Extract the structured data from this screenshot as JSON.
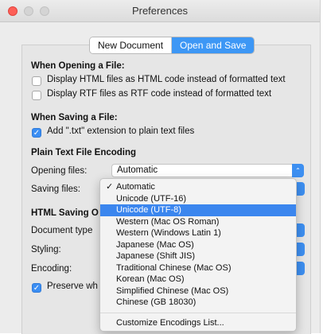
{
  "window": {
    "title": "Preferences"
  },
  "tabs": [
    {
      "label": "New Document",
      "active": false
    },
    {
      "label": "Open and Save",
      "active": true
    }
  ],
  "opening": {
    "heading": "When Opening a File:",
    "options": [
      {
        "label": "Display HTML files as HTML code instead of formatted text",
        "checked": false
      },
      {
        "label": "Display RTF files as RTF code instead of formatted text",
        "checked": false
      }
    ]
  },
  "saving": {
    "heading": "When Saving a File:",
    "options": [
      {
        "label": "Add \".txt\" extension to plain text files",
        "checked": true
      }
    ]
  },
  "encoding": {
    "heading": "Plain Text File Encoding",
    "opening_label": "Opening files:",
    "opening_value": "Automatic",
    "saving_label": "Saving files:"
  },
  "html_saving": {
    "heading_partial": "HTML Saving O",
    "doctype_label": "Document type",
    "styling_label": "Styling:",
    "encoding_label": "Encoding:",
    "preserve_partial": "Preserve wh"
  },
  "menu": {
    "items": [
      {
        "label": "Automatic",
        "checked": true,
        "selected": false
      },
      {
        "label": "Unicode (UTF-16)",
        "checked": false,
        "selected": false
      },
      {
        "label": "Unicode (UTF-8)",
        "checked": false,
        "selected": true
      },
      {
        "label": "Western (Mac OS Roman)",
        "checked": false,
        "selected": false
      },
      {
        "label": "Western (Windows Latin 1)",
        "checked": false,
        "selected": false
      },
      {
        "label": "Japanese (Mac OS)",
        "checked": false,
        "selected": false
      },
      {
        "label": "Japanese (Shift JIS)",
        "checked": false,
        "selected": false
      },
      {
        "label": "Traditional Chinese (Mac OS)",
        "checked": false,
        "selected": false
      },
      {
        "label": "Korean (Mac OS)",
        "checked": false,
        "selected": false
      },
      {
        "label": "Simplified Chinese (Mac OS)",
        "checked": false,
        "selected": false
      },
      {
        "label": "Chinese (GB 18030)",
        "checked": false,
        "selected": false
      }
    ],
    "footer_item": "Customize Encodings List..."
  },
  "colors": {
    "accent": "#3d8ff1",
    "selected_row": "#3b86ee"
  }
}
